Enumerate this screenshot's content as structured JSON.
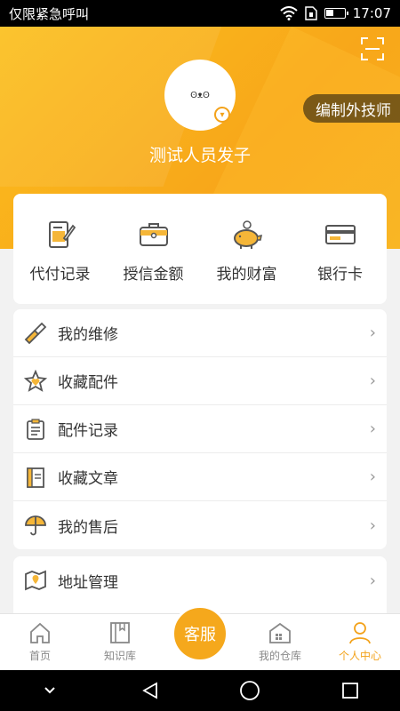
{
  "status": {
    "left": "仅限紧急呼叫",
    "time": "17:07"
  },
  "profile": {
    "username": "测试人员发子",
    "tech_button": "编制外技师",
    "avatar_text": "ʘᴥʘ",
    "vip_icon": "chevron-down-circle-icon"
  },
  "quick": [
    {
      "label": "代付记录",
      "icon": "clipboard-pen-icon"
    },
    {
      "label": "授信金额",
      "icon": "briefcase-icon"
    },
    {
      "label": "我的财富",
      "icon": "piggy-bank-icon"
    },
    {
      "label": "银行卡",
      "icon": "bank-card-icon"
    }
  ],
  "menu": [
    {
      "label": "我的维修",
      "icon": "screwdriver-icon"
    },
    {
      "label": "收藏配件",
      "icon": "star-heart-icon"
    },
    {
      "label": "配件记录",
      "icon": "clipboard-list-icon"
    },
    {
      "label": "收藏文章",
      "icon": "book-icon"
    },
    {
      "label": "我的售后",
      "icon": "umbrella-icon"
    }
  ],
  "menu2": [
    {
      "label": "地址管理",
      "icon": "map-icon"
    }
  ],
  "tabs": {
    "home": "首页",
    "knowledge": "知识库",
    "service": "客服",
    "warehouse": "我的仓库",
    "personal": "个人中心"
  },
  "colors": {
    "accent": "#f3a21a",
    "header": "#fbbf1d"
  }
}
